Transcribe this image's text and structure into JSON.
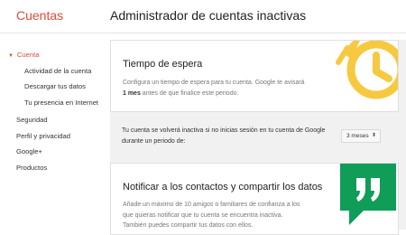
{
  "header": {
    "brand": "Cuentas",
    "title": "Administrador de cuentas inactivas"
  },
  "sidebar": {
    "items": [
      {
        "label": "Cuenta",
        "active": true
      },
      {
        "label": "Actividad de la cuenta"
      },
      {
        "label": "Descargar tus datos"
      },
      {
        "label": "Tu presencia en Internet"
      },
      {
        "label": "Seguridad"
      },
      {
        "label": "Perfil y privacidad"
      },
      {
        "label": "Google+"
      },
      {
        "label": "Productos"
      }
    ]
  },
  "timeout_card": {
    "title": "Tiempo de espera",
    "text_before": "Configura un tiempo de espera para tu cuenta. Google te avisará ",
    "text_bold": "1 mes",
    "text_after": " antes de que finalice este periodo.",
    "icon": "alarm-clock-icon"
  },
  "inactivity_band": {
    "text": "Tu cuenta se volverá inactiva si no inicias sesión en tu cuenta de Google durante un periodo de:",
    "select_value": "3 meses"
  },
  "notify_card": {
    "title": "Notificar a los contactos y compartir los datos",
    "text": "Añade un máximo de 10 amigos o familiares de confianza a los que quieras notificar que tu cuenta se encuentra inactiva. También puedes compartir tus datos con ellos.",
    "icon": "quote-chat-icon"
  },
  "colors": {
    "brand": "#dd4b39",
    "clock_yellow": "#f7c940",
    "chat_green": "#0f9d58",
    "band_bg": "#f1f1f1"
  }
}
